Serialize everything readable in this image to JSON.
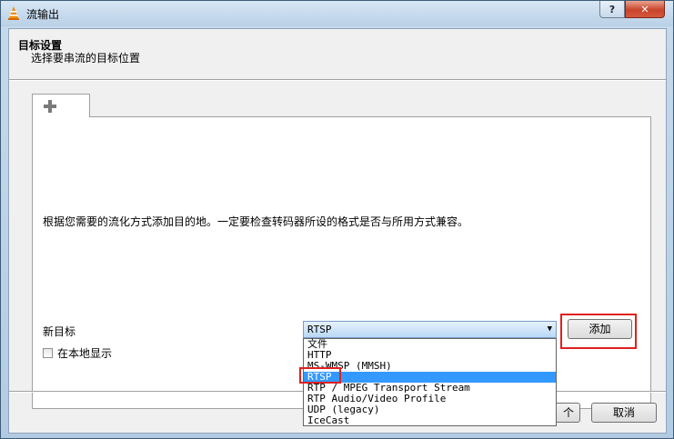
{
  "window": {
    "title": "流输出",
    "help_label": "?",
    "close_label": "✕"
  },
  "header": {
    "title": "目标设置",
    "subtitle": "选择要串流的目标位置"
  },
  "tab": {
    "icon": "plus-icon"
  },
  "panel": {
    "info": "根据您需要的流化方式添加目的地。一定要检查转码器所设的格式是否与所用方式兼容。",
    "new_target_label": "新目标",
    "local_display_label": "在本地显示",
    "local_display_checked": false
  },
  "select": {
    "value": "RTSP",
    "options": [
      "文件",
      "HTTP",
      "MS-WMSP (MMSH)",
      "RTSP",
      "RTP / MPEG Transport Stream",
      "RTP Audio/Video Profile",
      "UDP (legacy)",
      "IceCast"
    ],
    "selected_index": 3
  },
  "add_button": "添加",
  "footer": {
    "next_partial": "个",
    "cancel": "取消"
  },
  "colors": {
    "highlight": "#e02020",
    "selection": "#3399ff"
  }
}
